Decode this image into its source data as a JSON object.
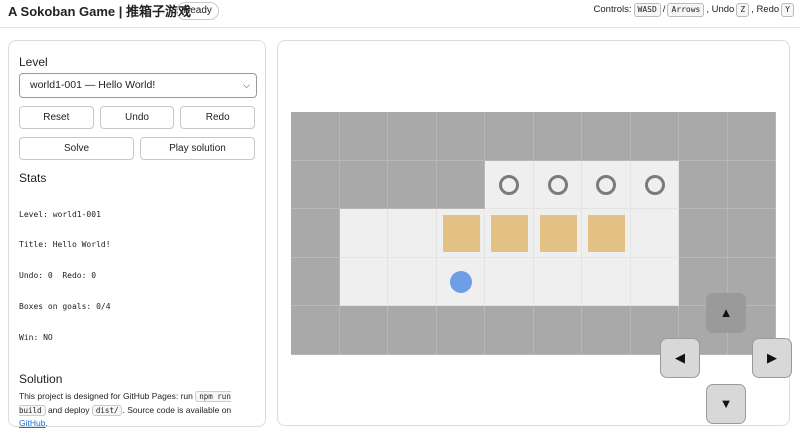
{
  "header": {
    "title": "A Sokoban Game | 推箱子游戏",
    "status": "Ready",
    "controls_label": "Controls:",
    "key_wasd": "WASD",
    "sep": "/",
    "key_arrows": "Arrows",
    "undo_label": ", Undo",
    "key_undo": "Z",
    "redo_label": ", Redo",
    "key_redo": "Y"
  },
  "sidebar": {
    "level_heading": "Level",
    "level_select": "world1-001 — Hello World!",
    "buttons": {
      "reset": "Reset",
      "undo": "Undo",
      "redo": "Redo",
      "solve": "Solve",
      "play_solution": "Play solution"
    },
    "stats_heading": "Stats",
    "stats_lines": [
      "Level: world1-001",
      "Title: Hello World!",
      "Undo: 0  Redo: 0",
      "Boxes on goals: 0/4",
      "Win: NO"
    ],
    "solution_heading": "Solution",
    "solution": {
      "text1": "This project is designed for GitHub Pages: run ",
      "code1": "npm run build",
      "text2": " and deploy ",
      "code2": "dist/",
      "text3": ". Source code is available on ",
      "link": "GitHub",
      "text4": "."
    }
  },
  "board": {
    "cols": 10,
    "rows": 5,
    "map": [
      "##########",
      "####....##",
      "#.......##",
      "#.......##",
      "##########"
    ],
    "goals": [
      [
        1,
        4
      ],
      [
        1,
        5
      ],
      [
        1,
        6
      ],
      [
        1,
        7
      ]
    ],
    "boxes": [
      [
        2,
        3
      ],
      [
        2,
        4
      ],
      [
        2,
        5
      ],
      [
        2,
        6
      ]
    ],
    "player": [
      3,
      3
    ]
  },
  "dpad": {
    "up": "▲",
    "left": "◀",
    "right": "▶",
    "down": "▼"
  }
}
